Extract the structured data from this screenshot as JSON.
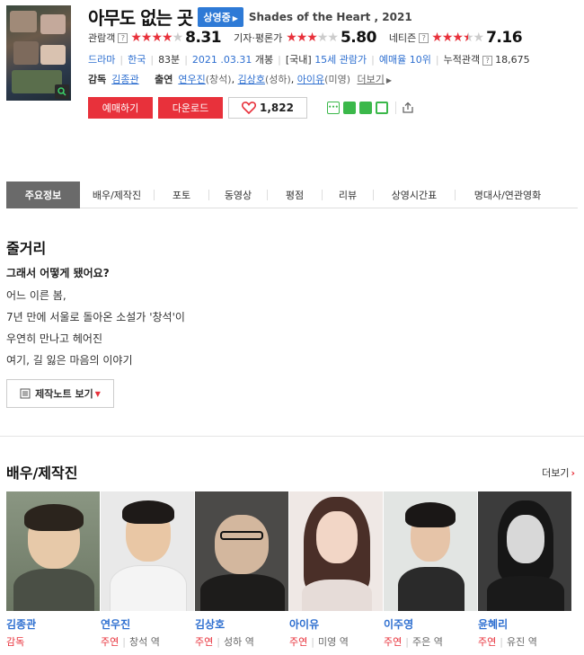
{
  "movie": {
    "title": "아무도 없는 곳",
    "status": "상영중",
    "en_title": "Shades of the Heart , 2021"
  },
  "ratings": [
    {
      "label": "관람객",
      "stars": 4,
      "score": "8.31"
    },
    {
      "label": "기자·평론가",
      "stars": 3,
      "score": "5.80"
    },
    {
      "label": "네티즌",
      "stars": 3.5,
      "score": "7.16"
    }
  ],
  "info": {
    "genre": "드라마",
    "country": "한국",
    "runtime": "83분",
    "release_date": "2021 .03.31",
    "release_suffix": "개봉",
    "rating_prefix": "[국내]",
    "rating": "15세 관람가",
    "rank": "예매율 10위",
    "cumulative_label": "누적관객",
    "cumulative_value": "18,675"
  },
  "credits": {
    "director_label": "감독",
    "director": "김종관",
    "cast_label": "출연",
    "cast": [
      {
        "name": "연우진",
        "role": "(창석)"
      },
      {
        "name": "김상호",
        "role": "(성하)"
      },
      {
        "name": "아이유",
        "role": "(미영)"
      }
    ],
    "more": "더보기"
  },
  "actions": {
    "reserve": "예매하기",
    "download": "다운로드",
    "likes": "1,822"
  },
  "tabs": [
    "주요정보",
    "배우/제작진",
    "포토",
    "동영상",
    "평점",
    "리뷰",
    "상영시간표",
    "명대사/연관영화"
  ],
  "synopsis": {
    "heading": "줄거리",
    "lead": "그래서 어떻게 됐어요?",
    "lines": [
      "어느 이른 봄,",
      " 7년 만에 서울로 돌아온 소설가 '창석'이",
      " 우연히 만나고 헤어진",
      " 여기, 길 잃은 마음의 이야기"
    ],
    "note_button": "제작노트 보기"
  },
  "cast_section": {
    "heading": "배우/제작진",
    "more": "더보기",
    "people": [
      {
        "name": "김종관",
        "type": "감독",
        "role": ""
      },
      {
        "name": "연우진",
        "type": "주연",
        "role": "창석 역"
      },
      {
        "name": "김상호",
        "type": "주연",
        "role": "성하 역"
      },
      {
        "name": "아이유",
        "type": "주연",
        "role": "미영 역"
      },
      {
        "name": "이주영",
        "type": "주연",
        "role": "주은 역"
      },
      {
        "name": "윤혜리",
        "type": "주연",
        "role": "유진 역"
      }
    ]
  },
  "colors": {
    "accent_red": "#e8313b",
    "link_blue": "#2e6fd0",
    "badge_blue": "#2e7ad6",
    "tab_active": "#6a6a6a"
  }
}
